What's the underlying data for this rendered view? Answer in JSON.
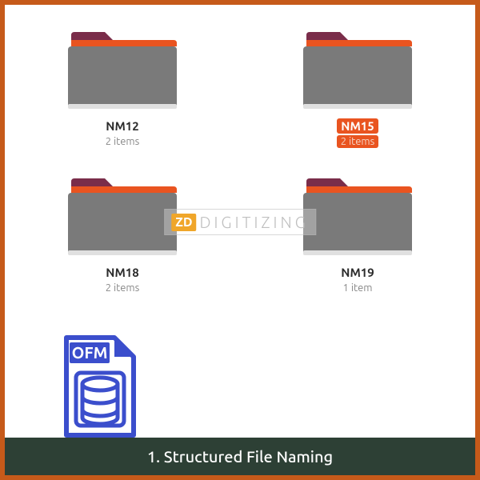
{
  "folders": [
    {
      "name": "NM12",
      "count": "2 items",
      "selected": false
    },
    {
      "name": "NM15",
      "count": "2 items",
      "selected": true
    },
    {
      "name": "NM18",
      "count": "2 items",
      "selected": false
    },
    {
      "name": "NM19",
      "count": "1 item",
      "selected": false
    }
  ],
  "file": {
    "ext_label": "OFM"
  },
  "watermark": {
    "badge": "ZD",
    "text": "DIGITIZING"
  },
  "caption": "1. Structured File Naming"
}
